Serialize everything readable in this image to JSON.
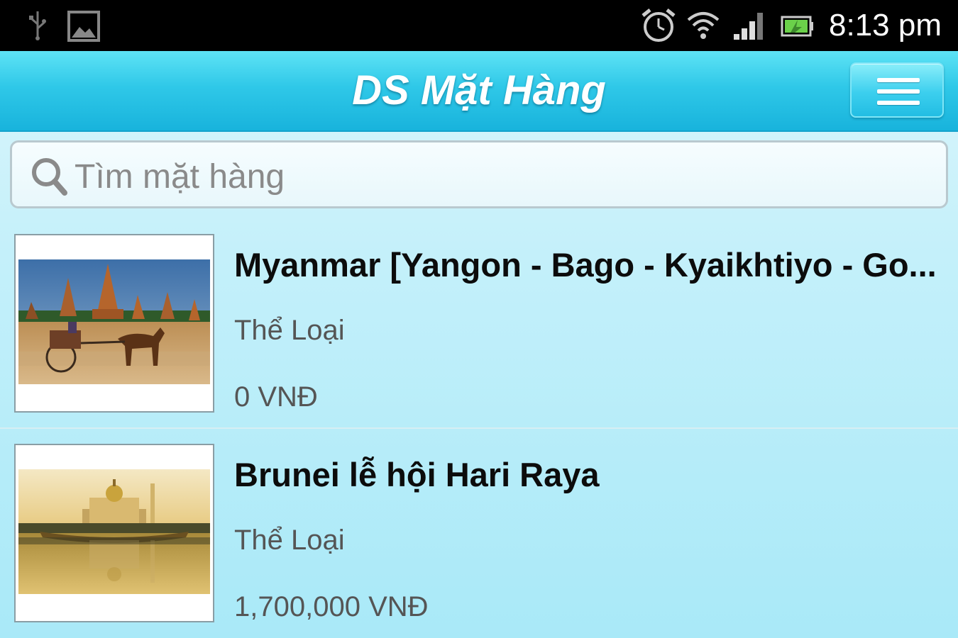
{
  "status_bar": {
    "time": "8:13 pm",
    "icons": [
      "usb-icon",
      "image-notification-icon",
      "alarm-icon",
      "wifi-icon",
      "signal-icon",
      "battery-icon"
    ]
  },
  "header": {
    "title": "DS Mặt Hàng",
    "menu_icon": "hamburger-menu-icon"
  },
  "search": {
    "placeholder": "Tìm mặt hàng",
    "value": "",
    "icon": "search-icon"
  },
  "items": [
    {
      "title": "Myanmar [Yangon - Bago - Kyaikhtiyo - Golden Rock]",
      "title_display": "Myanmar [Yangon - Bago - Kyaikhtiyo - Go...",
      "category": "Thể Loại",
      "price": "0 VNĐ"
    },
    {
      "title": "Brunei lễ hội Hari Raya",
      "title_display": "Brunei lễ hội Hari Raya",
      "category": "Thể Loại",
      "price": "1,700,000 VNĐ"
    }
  ],
  "colors": {
    "header_top": "#5ee3f5",
    "header_bottom": "#18b3dc",
    "background": "#c4f0fa",
    "status_bar": "#000000"
  }
}
